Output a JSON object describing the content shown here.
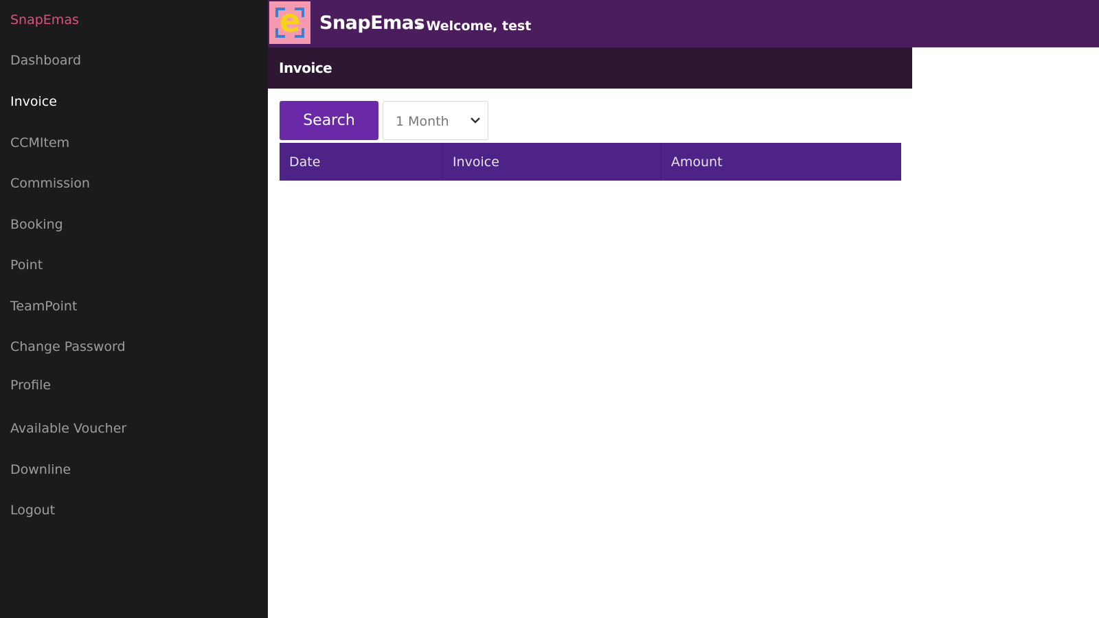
{
  "sidebar": {
    "brand": "SnapEmas",
    "items": [
      {
        "label": "Dashboard",
        "active": false
      },
      {
        "label": "Invoice",
        "active": true
      },
      {
        "label": "CCMItem",
        "active": false
      },
      {
        "label": "Commission",
        "active": false
      },
      {
        "label": "Booking",
        "active": false
      },
      {
        "label": "Point",
        "active": false
      },
      {
        "label": "TeamPoint",
        "active": false
      },
      {
        "label": "Change Password",
        "active": false
      },
      {
        "label": "Profile",
        "active": false
      },
      {
        "label": "Available Voucher",
        "active": false
      },
      {
        "label": "Downline",
        "active": false
      },
      {
        "label": "Logout",
        "active": false
      }
    ]
  },
  "header": {
    "logo_letter": "e",
    "app_title": "SnapEmas",
    "welcome": "- Welcome, test"
  },
  "page": {
    "title": "Invoice"
  },
  "toolbar": {
    "search_label": "Search",
    "period_selected": "1 Month"
  },
  "table": {
    "columns": [
      "Date",
      "Invoice",
      "Amount"
    ],
    "rows": []
  },
  "colors": {
    "sidebar_bg": "#1b1b1d",
    "topbar_bg": "#4b1d5c",
    "page_header_bg": "#2d1733",
    "accent_button": "#6a2aa7",
    "table_header": "#4e2388",
    "brand_link": "#e0517a"
  }
}
